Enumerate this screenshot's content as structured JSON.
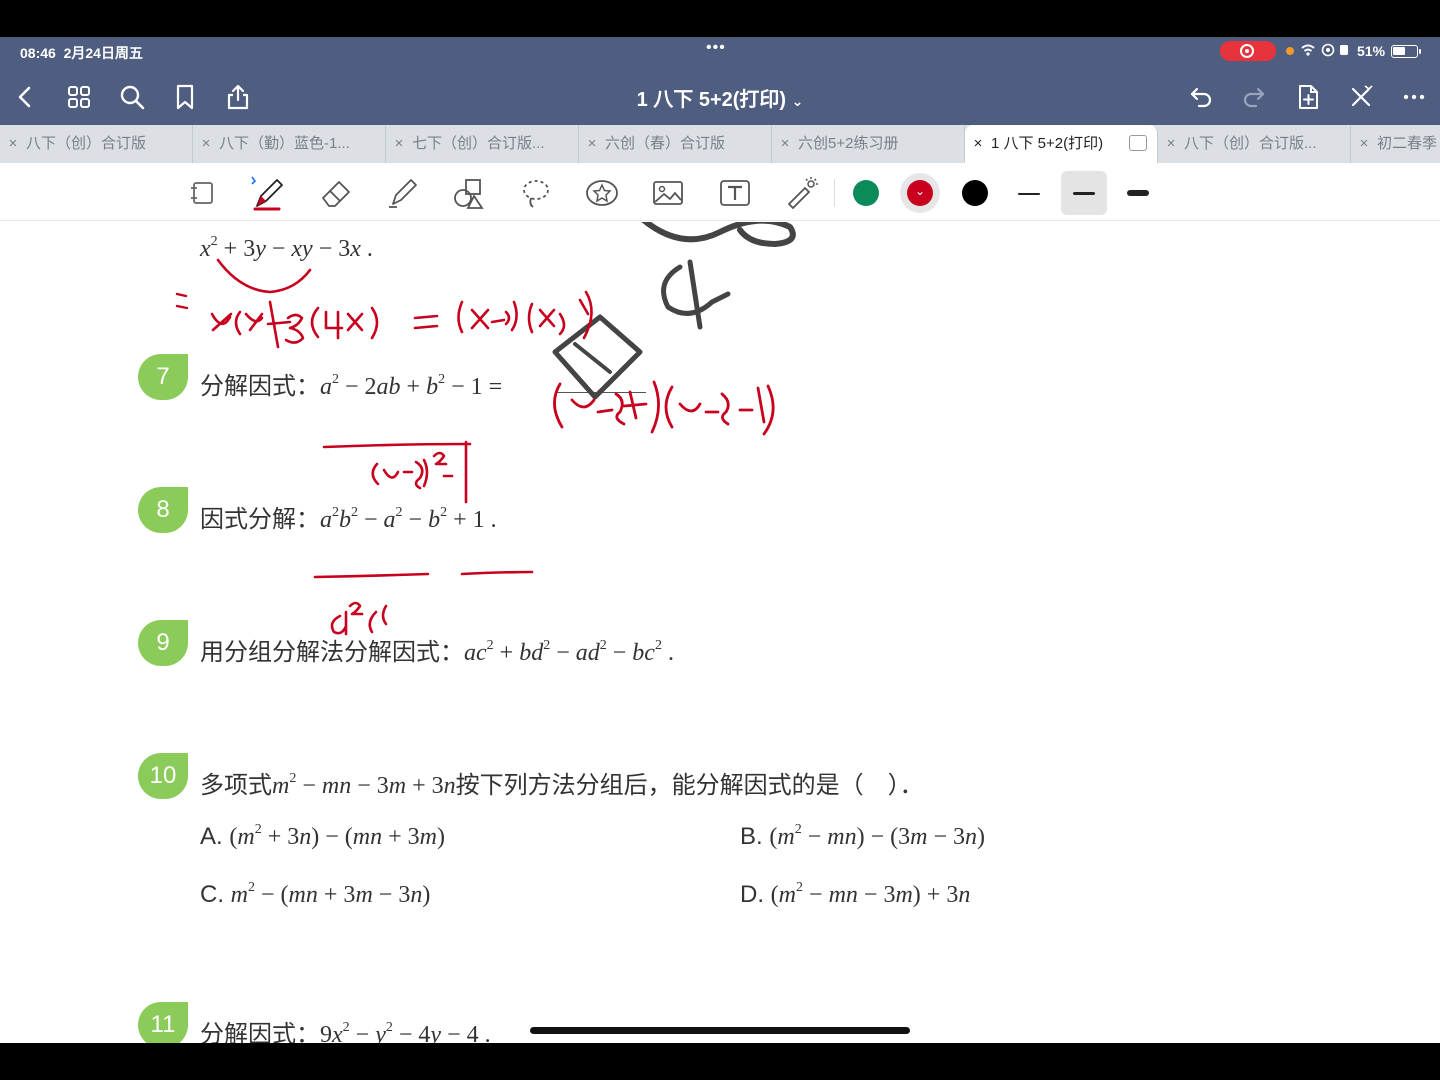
{
  "status": {
    "time": "08:46",
    "date": "2月24日周五",
    "battery": "51%",
    "battery_level": 0.51
  },
  "nav": {
    "title": "1 八下 5+2(打印)"
  },
  "tabs": [
    {
      "label": "八下（创）合订版"
    },
    {
      "label": "八下（勤）蓝色-1..."
    },
    {
      "label": "七下（创）合订版..."
    },
    {
      "label": "六创（春）合订版"
    },
    {
      "label": "六创5+2练习册"
    },
    {
      "label": "1 八下 5+2(打印)"
    },
    {
      "label": "八下（创）合订版..."
    },
    {
      "label": "初二春季"
    }
  ],
  "toolbar": {
    "colors": [
      "#0b8a5a",
      "#c8001e",
      "#000000"
    ],
    "selected_color": "#c8001e"
  },
  "questions": [
    {
      "number": "7",
      "prompt": "分解因式："
    },
    {
      "number": "8",
      "prompt": "因式分解："
    },
    {
      "number": "9",
      "prompt": "用分组分解法分解因式："
    },
    {
      "number": "10",
      "prompt_a": "多项式",
      "prompt_b": "按下列方法分组后，能分解因式的是（　）．"
    },
    {
      "number": "11",
      "prompt": "分解因式："
    }
  ],
  "options": {
    "a": "A.",
    "b": "B.",
    "c": "C.",
    "d": "D."
  }
}
